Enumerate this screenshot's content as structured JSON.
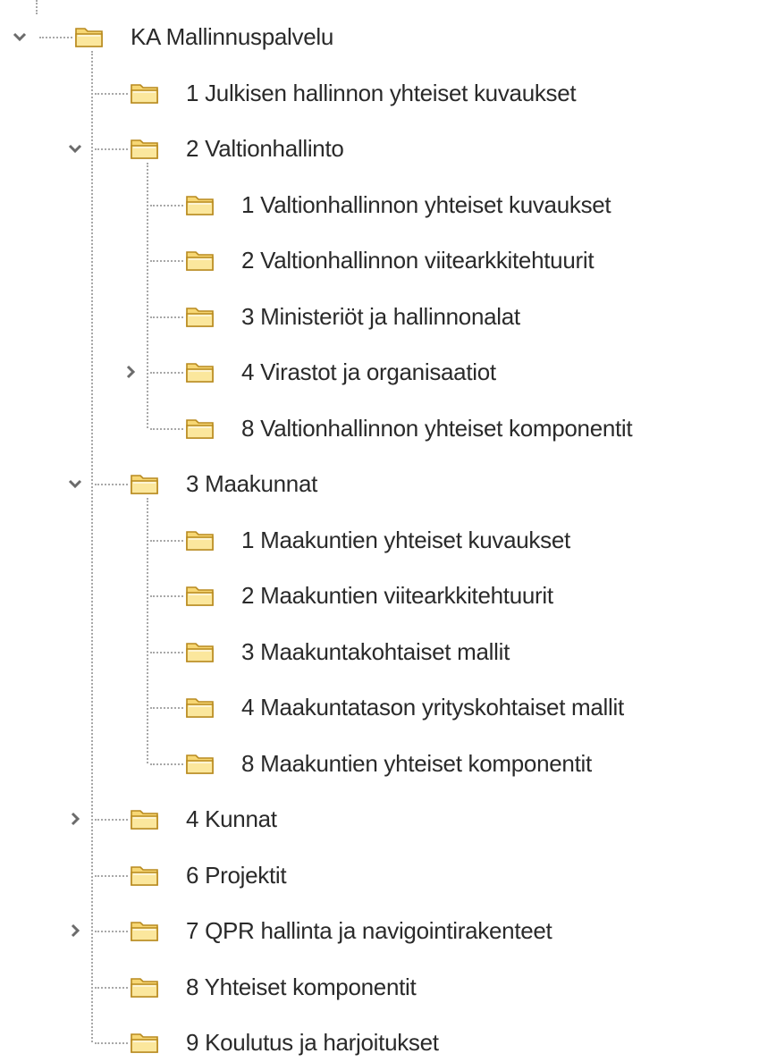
{
  "icons": {
    "expanded": "chevron-down-icon",
    "collapsed": "chevron-right-icon",
    "folder": "folder-icon"
  },
  "colors": {
    "folder_fill": "#f7d774",
    "folder_edge": "#b88a1e",
    "guide": "#a8a8a8",
    "text": "#2a2a2a",
    "toggle": "#6b6b6b"
  },
  "tree": [
    {
      "id": "root",
      "label": "KA Mallinnuspalvelu",
      "level": 0,
      "state": "expanded",
      "last": true,
      "top_node": true
    },
    {
      "id": "julkisen-hallinnon",
      "label": "1 Julkisen hallinnon yhteiset kuvaukset",
      "level": 1,
      "state": "leaf"
    },
    {
      "id": "valtionhallinto",
      "label": "2 Valtionhallinto",
      "level": 1,
      "state": "expanded"
    },
    {
      "id": "vh-yhteiset-kuvaukset",
      "label": "1 Valtionhallinnon yhteiset kuvaukset",
      "level": 2,
      "state": "leaf"
    },
    {
      "id": "vh-viitearkkitehtuurit",
      "label": "2 Valtionhallinnon viitearkkitehtuurit",
      "level": 2,
      "state": "leaf"
    },
    {
      "id": "ministeriot",
      "label": "3 Ministeriöt ja hallinnonalat",
      "level": 2,
      "state": "leaf"
    },
    {
      "id": "virastot",
      "label": "4 Virastot ja organisaatiot",
      "level": 2,
      "state": "collapsed"
    },
    {
      "id": "vh-yhteiset-komponentit",
      "label": "8 Valtionhallinnon yhteiset komponentit",
      "level": 2,
      "state": "leaf",
      "last": true
    },
    {
      "id": "maakunnat",
      "label": "3 Maakunnat",
      "level": 1,
      "state": "expanded"
    },
    {
      "id": "mk-yhteiset-kuvaukset",
      "label": "1 Maakuntien yhteiset kuvaukset",
      "level": 2,
      "state": "leaf"
    },
    {
      "id": "mk-viitearkkitehtuurit",
      "label": "2 Maakuntien viitearkkitehtuurit",
      "level": 2,
      "state": "leaf"
    },
    {
      "id": "mk-kohtaiset-mallit",
      "label": "3 Maakuntakohtaiset mallit",
      "level": 2,
      "state": "leaf"
    },
    {
      "id": "mk-yrityskohtaiset",
      "label": "4 Maakuntatason yrityskohtaiset mallit",
      "level": 2,
      "state": "leaf"
    },
    {
      "id": "mk-yhteiset-komponentit",
      "label": "8 Maakuntien yhteiset komponentit",
      "level": 2,
      "state": "leaf",
      "last": true
    },
    {
      "id": "kunnat",
      "label": "4 Kunnat",
      "level": 1,
      "state": "collapsed"
    },
    {
      "id": "projektit",
      "label": "6 Projektit",
      "level": 1,
      "state": "leaf"
    },
    {
      "id": "qpr-hallinta",
      "label": "7 QPR hallinta ja navigointirakenteet",
      "level": 1,
      "state": "collapsed"
    },
    {
      "id": "yhteiset-komponentit",
      "label": "8 Yhteiset komponentit",
      "level": 1,
      "state": "leaf"
    },
    {
      "id": "koulutus",
      "label": "9 Koulutus ja harjoitukset",
      "level": 1,
      "state": "leaf",
      "last": true
    }
  ]
}
